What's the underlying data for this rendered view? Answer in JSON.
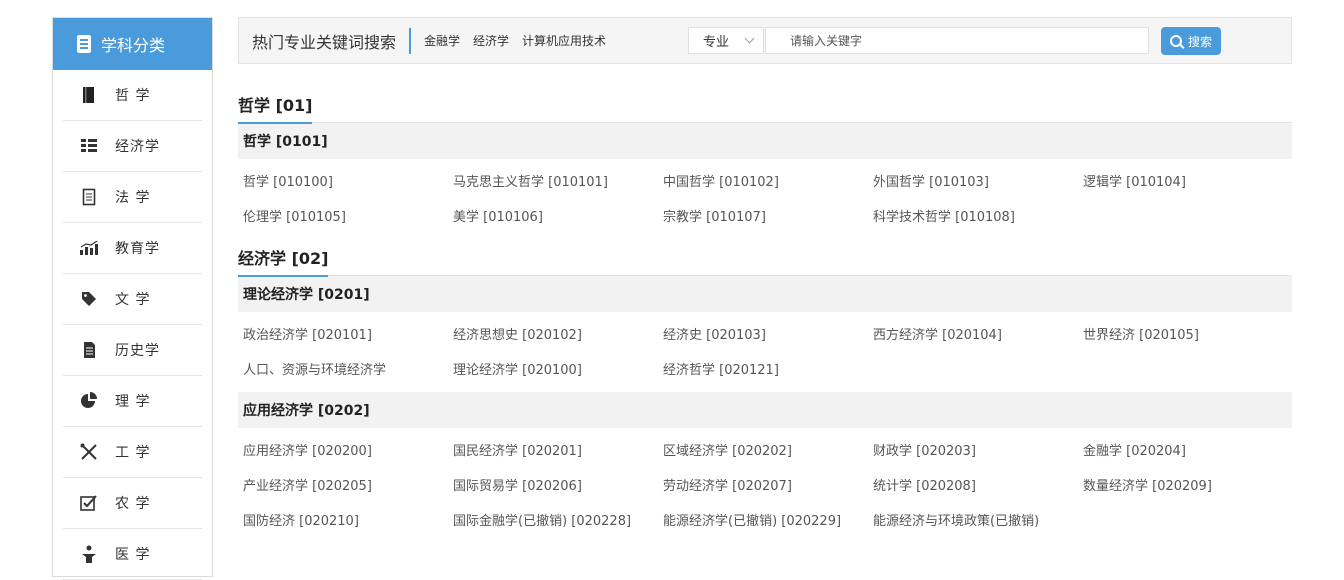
{
  "sidebar": {
    "title": "学科分类",
    "items": [
      {
        "label": "哲 学",
        "icon": "book-icon"
      },
      {
        "label": "经济学",
        "icon": "grid-list-icon"
      },
      {
        "label": "法 学",
        "icon": "notebook-icon"
      },
      {
        "label": "教育学",
        "icon": "bar-chart-icon"
      },
      {
        "label": "文 学",
        "icon": "tag-icon"
      },
      {
        "label": "历史学",
        "icon": "document-icon"
      },
      {
        "label": "理 学",
        "icon": "pie-chart-icon"
      },
      {
        "label": "工 学",
        "icon": "tools-icon"
      },
      {
        "label": "农 学",
        "icon": "checkbox-icon"
      },
      {
        "label": "医 学",
        "icon": "medical-icon"
      }
    ]
  },
  "search": {
    "title": "热门专业关键词搜索",
    "hot_keywords": [
      "金融学",
      "经济学",
      "计算机应用技术"
    ],
    "select_value": "专业",
    "placeholder": "请输入关键字",
    "button_label": "搜索"
  },
  "sections": [
    {
      "title": "哲学 [01]",
      "groups": [
        {
          "title": "哲学 [0101]",
          "items": [
            "哲学 [010100]",
            "马克思主义哲学 [010101]",
            "中国哲学 [010102]",
            "外国哲学 [010103]",
            "逻辑学 [010104]",
            "伦理学 [010105]",
            "美学 [010106]",
            "宗教学 [010107]",
            "科学技术哲学 [010108]"
          ]
        }
      ]
    },
    {
      "title": "经济学 [02]",
      "groups": [
        {
          "title": "理论经济学 [0201]",
          "items": [
            "政治经济学 [020101]",
            "经济思想史 [020102]",
            "经济史 [020103]",
            "西方经济学 [020104]",
            "世界经济 [020105]",
            "人口、资源与环境经济学",
            "理论经济学 [020100]",
            "经济哲学 [020121]"
          ]
        },
        {
          "title": "应用经济学 [0202]",
          "items": [
            "应用经济学 [020200]",
            "国民经济学 [020201]",
            "区域经济学 [020202]",
            "财政学 [020203]",
            "金融学 [020204]",
            "产业经济学 [020205]",
            "国际贸易学 [020206]",
            "劳动经济学 [020207]",
            "统计学 [020208]",
            "数量经济学 [020209]",
            "国防经济 [020210]",
            "国际金融学(已撤销) [020228]",
            "能源经济学(已撤销) [020229]",
            "能源经济与环境政策(已撤销)"
          ]
        }
      ]
    }
  ],
  "colors": {
    "accent": "#4a9bdc",
    "sub_bg": "#f2f2f2"
  }
}
